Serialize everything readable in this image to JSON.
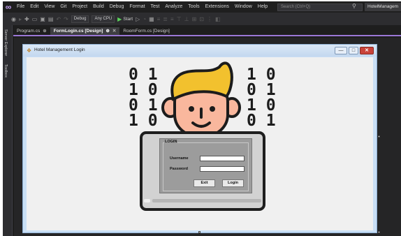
{
  "menubar": {
    "logo": "∞",
    "items": [
      "File",
      "Edit",
      "View",
      "Git",
      "Project",
      "Build",
      "Debug",
      "Format",
      "Test",
      "Analyze",
      "Tools",
      "Extensions",
      "Window",
      "Help"
    ],
    "search_placeholder": "Search (Ctrl+Q)",
    "solution_name": "HotelManagem"
  },
  "toolbar": {
    "config": "Debug",
    "platform": "Any CPU",
    "start_label": "Start"
  },
  "side_tabs": [
    "Server Explorer",
    "Toolbox"
  ],
  "doc_tabs": [
    {
      "label": "Program.cs",
      "pin": "⊕"
    },
    {
      "label": "FormLogin.cs [Design]",
      "pin": "⊕",
      "close": "✕"
    },
    {
      "label": "RoomForm.cs [Design]"
    }
  ],
  "form": {
    "title": "Hotel Management Login",
    "minimize": "—",
    "maximize": "□",
    "close": "✕"
  },
  "illustration": {
    "binary_left": "0 1\n1 0\n0 1\n1 0",
    "binary_right": "1 0\n0 1\n1 0\n0 1",
    "login_title": "LOGIN",
    "username_label": "Username",
    "password_label": "Password",
    "exit_label": "Exit",
    "login_label": "Login"
  },
  "colors": {
    "hair": "#f2c12e",
    "skin": "#f9b79d",
    "accent": "#9b78d6",
    "start_green": "#5bd35b"
  }
}
